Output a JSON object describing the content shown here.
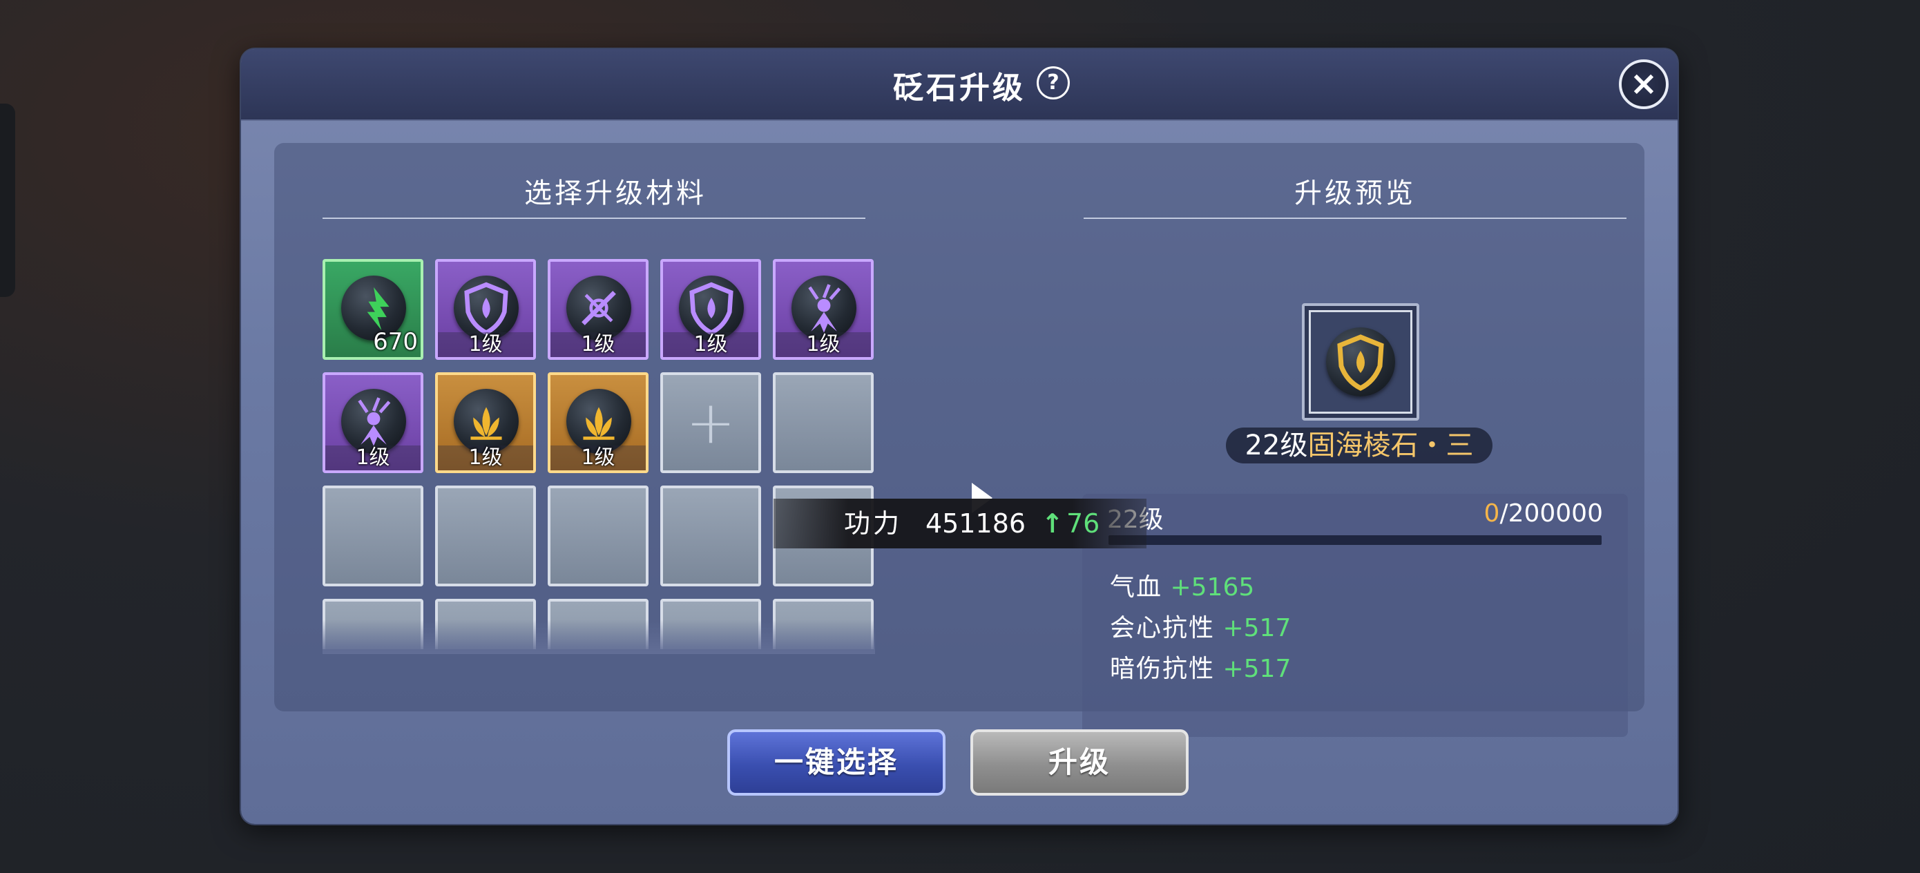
{
  "dialog": {
    "title": "砭石升级",
    "help_icon": "?",
    "close_icon": "×"
  },
  "materials": {
    "title": "选择升级材料",
    "slots": [
      {
        "quality": "green",
        "icon": "upgrade-arrow-stone-icon",
        "count": "670",
        "label": ""
      },
      {
        "quality": "purple",
        "icon": "shield-drop-stone-icon",
        "label": "1级"
      },
      {
        "quality": "purple",
        "icon": "sword-burst-stone-icon",
        "label": "1级"
      },
      {
        "quality": "purple",
        "icon": "shield-drop-stone-icon",
        "label": "1级"
      },
      {
        "quality": "purple",
        "icon": "figure-burst-stone-icon",
        "label": "1级"
      },
      {
        "quality": "purple",
        "icon": "figure-burst-stone-icon",
        "label": "1级"
      },
      {
        "quality": "orange",
        "icon": "lotus-stone-icon",
        "label": "1级"
      },
      {
        "quality": "orange",
        "icon": "lotus-stone-icon",
        "label": "1级"
      },
      {
        "quality": "add",
        "icon": "plus-icon",
        "label": "+"
      }
    ]
  },
  "preview": {
    "title": "升级预览",
    "item_icon": "gold-shield-drop-stone-icon",
    "level": "22级",
    "name": "固海棱石・三",
    "level_row": "22级",
    "exp_current": "0",
    "exp_total": "/200000",
    "exp_progress": 0,
    "stats": [
      {
        "name": "气血",
        "value": "+5165"
      },
      {
        "name": "会心抗性",
        "value": "+517"
      },
      {
        "name": "暗伤抗性",
        "value": "+517"
      }
    ]
  },
  "power_tooltip": {
    "label": "功力",
    "value": "451186",
    "up_icon": "↑",
    "delta": "76"
  },
  "buttons": {
    "select_label": "一键选择",
    "upgrade_label": "升级"
  },
  "colors": {
    "accent_green": "#5fe07a",
    "exp_orange": "#f5b54a",
    "name_gold": "#f5c66a"
  }
}
